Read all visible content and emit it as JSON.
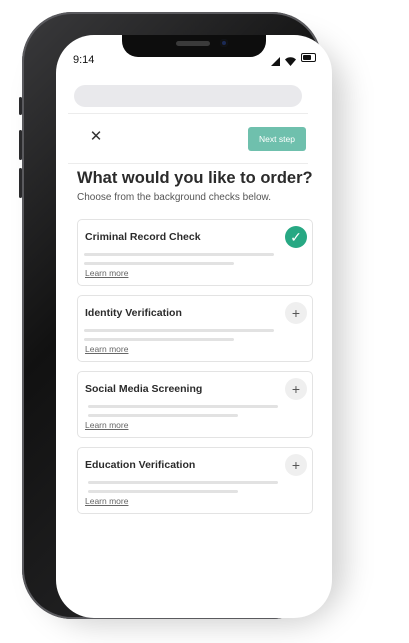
{
  "status_bar": {
    "time": "9:14"
  },
  "header": {
    "next_button_label": "Next step"
  },
  "page": {
    "title": "What would you like to order?",
    "subtitle": "Choose from the background checks below."
  },
  "checks": [
    {
      "name": "Criminal Record Check",
      "link": "Learn more",
      "selected": true,
      "action_icon": "check-icon"
    },
    {
      "name": "Identity Verification",
      "link": "Learn more",
      "selected": false,
      "action_icon": "plus-icon"
    },
    {
      "name": "Social Media Screening",
      "link": "Learn more",
      "selected": false,
      "action_icon": "plus-icon"
    },
    {
      "name": "Education Verification",
      "link": "Learn more",
      "selected": false,
      "action_icon": "plus-icon"
    }
  ],
  "colors": {
    "accent": "#27a883",
    "button": "#6fc0ad"
  }
}
